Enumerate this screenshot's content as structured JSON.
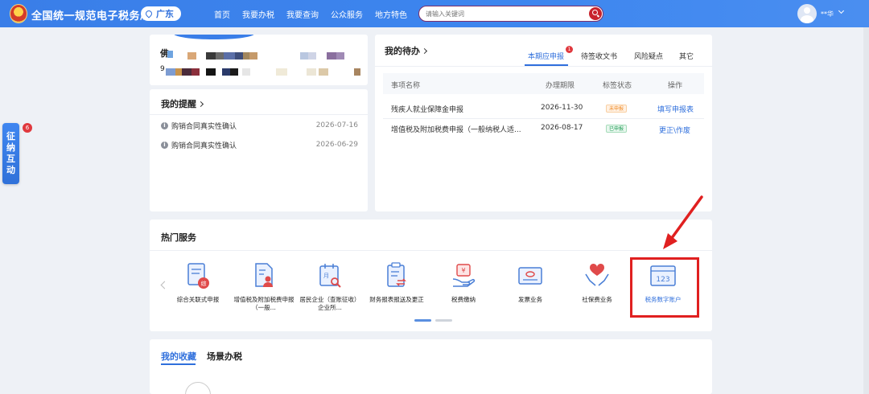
{
  "header": {
    "site_title": "全国统一规范电子税务局",
    "region": "广东",
    "nav": [
      "首页",
      "我要办税",
      "我要查询",
      "公众服务",
      "地方特色"
    ],
    "search_placeholder": "请输入关键词",
    "username": "**华"
  },
  "profile": {
    "name_prefix": "佛",
    "id_prefix": "9"
  },
  "reminders": {
    "title": "我的提醒",
    "items": [
      {
        "text": "购销合同真实性确认",
        "date": "2026-07-16"
      },
      {
        "text": "购销合同真实性确认",
        "date": "2026-06-29"
      }
    ]
  },
  "todo": {
    "title": "我的待办",
    "tabs": [
      "本期应申报",
      "待签收文书",
      "风险疑点",
      "其它"
    ],
    "tab_badge": "1",
    "columns": [
      "事项名称",
      "办理期限",
      "标签状态",
      "操作"
    ],
    "rows": [
      {
        "name": "残疾人就业保障金申报",
        "deadline": "2026-11-30",
        "status": "未申报",
        "action": "填写申报表"
      },
      {
        "name": "增值税及附加税费申报（一般纳税人适...",
        "deadline": "2026-08-17",
        "status": "已申报",
        "action": "更正\\作废"
      }
    ]
  },
  "hot_services": {
    "title": "热门服务",
    "items": [
      {
        "label": "综合关联式申报",
        "icon": "document-tax-icon"
      },
      {
        "label": "增值税及附加税费申报（一般...",
        "icon": "document-person-icon"
      },
      {
        "label": "居民企业（查账征收）企业所...",
        "icon": "calendar-search-icon"
      },
      {
        "label": "财务报表报送及更正",
        "icon": "clipboard-exchange-icon"
      },
      {
        "label": "税费缴纳",
        "icon": "hand-payment-icon"
      },
      {
        "label": "发票业务",
        "icon": "invoice-icon"
      },
      {
        "label": "社保费业务",
        "icon": "hands-heart-icon"
      },
      {
        "label": "税务数字账户",
        "icon": "digital-account-icon"
      }
    ]
  },
  "favorites": {
    "tabs": [
      "我的收藏",
      "场景办税"
    ]
  },
  "side_widget": {
    "chars": [
      "征",
      "纳",
      "互",
      "动"
    ],
    "badge": "6"
  },
  "colors": {
    "primary": "#3a7ee8",
    "highlight": "#e02020",
    "badge": "#e0393e"
  }
}
